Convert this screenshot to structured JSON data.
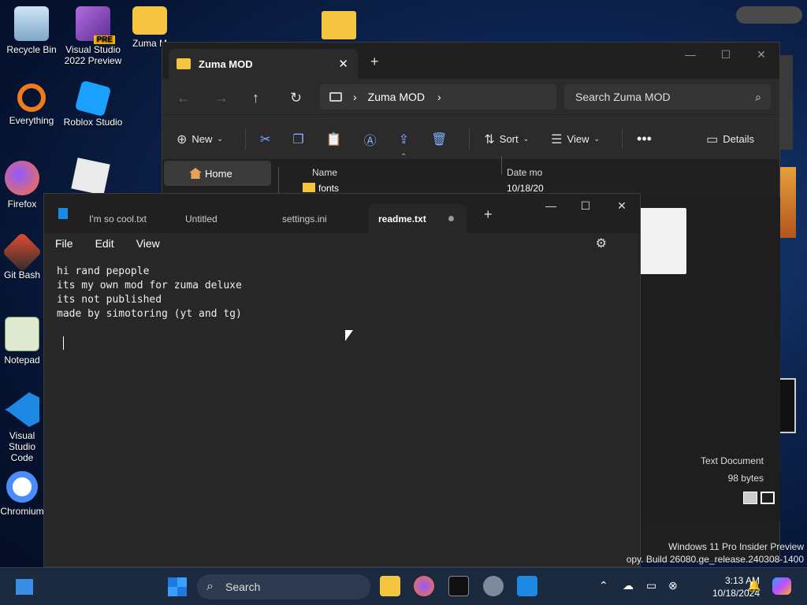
{
  "desktop": {
    "icons": [
      {
        "label": "Recycle Bin"
      },
      {
        "label": "Visual Studio 2022 Preview",
        "badge": "PRE"
      },
      {
        "label": "Zuma M"
      },
      {
        "label": "Everything"
      },
      {
        "label": "Roblox Studio"
      },
      {
        "label": "Firefox"
      },
      {
        "label": "Git Bash"
      },
      {
        "label": "Notepad"
      },
      {
        "label": "Visual Studio Code"
      },
      {
        "label": "Chromium"
      }
    ]
  },
  "explorer": {
    "tab_title": "Zuma MOD",
    "breadcrumb": "Zuma MOD",
    "search_placeholder": "Search Zuma MOD",
    "commands": {
      "new": "New",
      "sort": "Sort",
      "view": "View",
      "details": "Details"
    },
    "nav_home": "Home",
    "columns": {
      "name": "Name",
      "date": "Date mo"
    },
    "rows": [
      {
        "name": "fonts",
        "date": "10/18/20"
      }
    ],
    "detail_type": "Text Document",
    "detail_size": "98 bytes"
  },
  "notepad": {
    "tabs": [
      "I'm so cool.txt",
      "Untitled",
      "settings.ini",
      "readme.txt"
    ],
    "active_tab": 3,
    "menu": {
      "file": "File",
      "edit": "Edit",
      "view": "View"
    },
    "content": {
      "line1": "hi rand pepople",
      "line2": "its my own mod for zuma deluxe",
      "line3": "its not published",
      "line4": "made by simotoring (yt and tg)"
    }
  },
  "taskbar": {
    "search": "Search",
    "time": "3:13 AM",
    "date": "10/18/2024"
  },
  "watermark": {
    "line1": "Windows 11 Pro Insider Preview",
    "line2": "opy. Build 26080.ge_release.240308-1400"
  }
}
